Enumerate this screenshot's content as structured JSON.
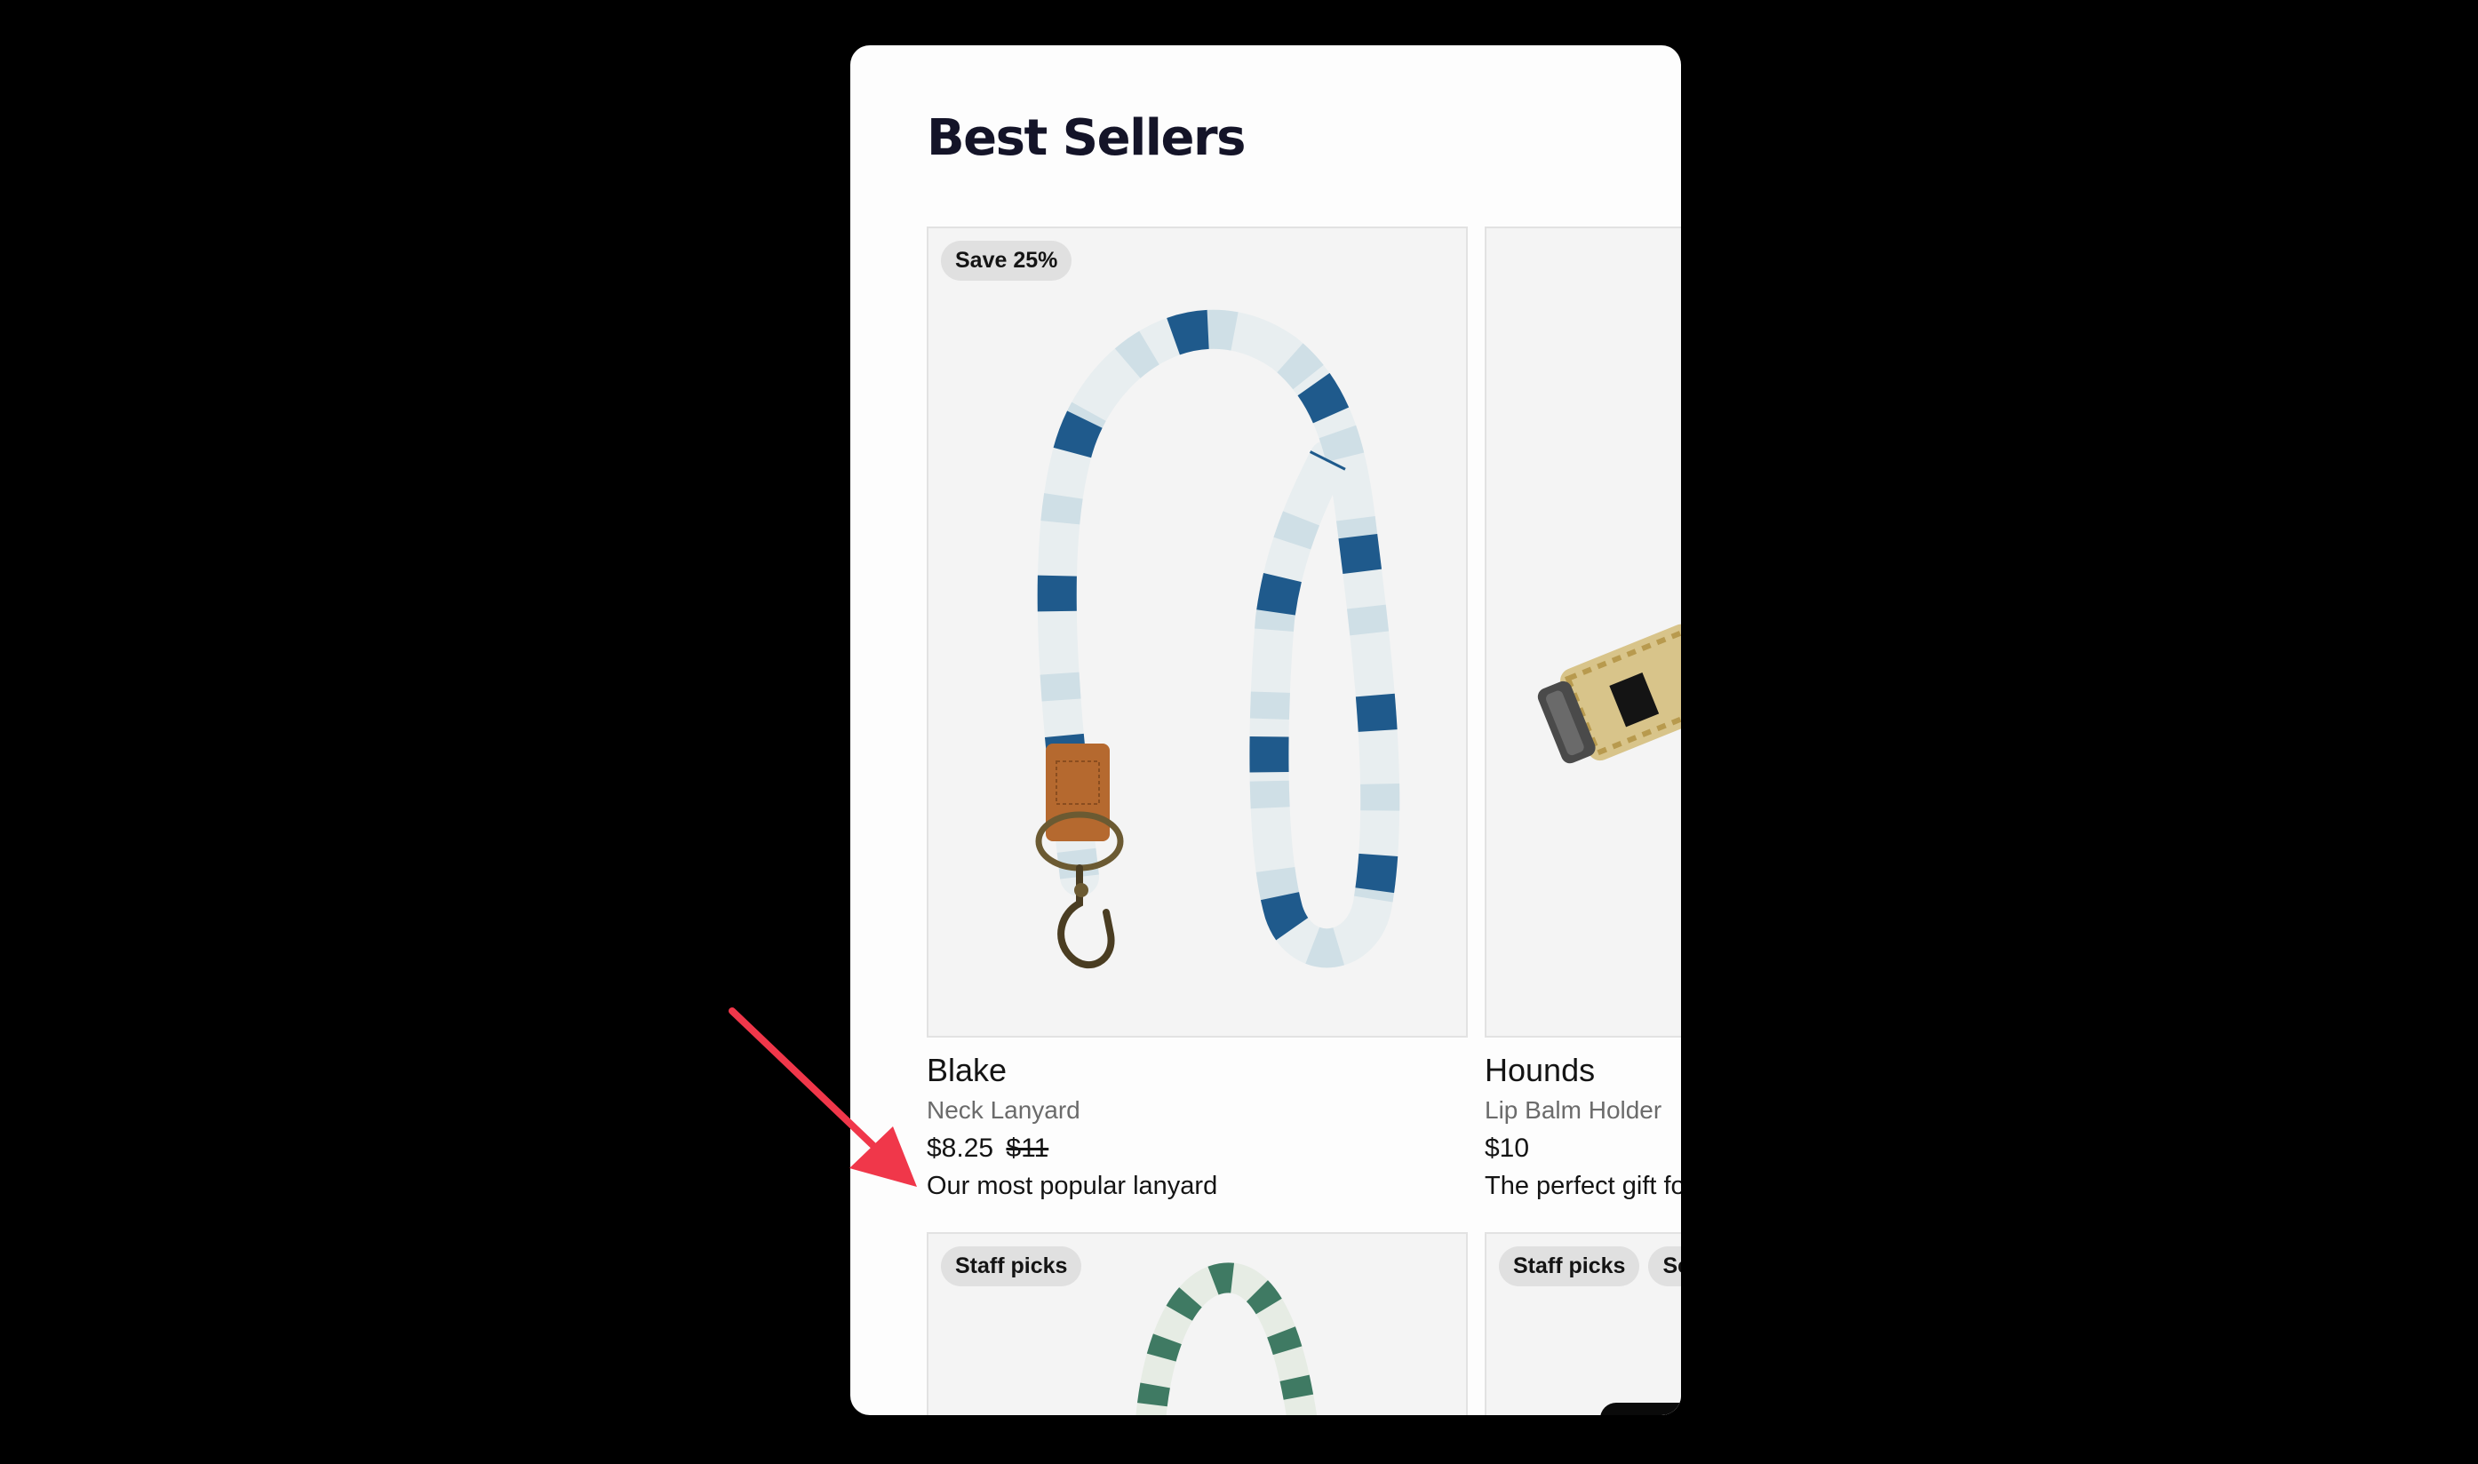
{
  "section": {
    "title": "Best Sellers"
  },
  "products": [
    {
      "badges": [
        "Save 25%"
      ],
      "name": "Blake",
      "type": "Neck Lanyard",
      "price": "$8.25",
      "old_price": "$11",
      "tagline": "Our most popular lanyard",
      "image_icon": "neck-lanyard-image"
    },
    {
      "badges": [],
      "name": "Hounds",
      "type": "Lip Balm Holder",
      "price": "$10",
      "tagline": "The perfect gift fo",
      "image_icon": "lip-balm-holder-image"
    },
    {
      "badges": [
        "Staff picks"
      ],
      "image_icon": "lanyard-image"
    },
    {
      "badges": [
        "Staff picks",
        "Se"
      ],
      "image_icon": "product-image"
    }
  ],
  "annotation": {
    "arrow_color": "#f0374a",
    "arrow_icon": "arrow-annotation-icon"
  },
  "colors": {
    "background": "#000000",
    "panel": "#fdfdfd",
    "heading": "#141428",
    "badge": "#e0e0e0",
    "lanyard_blue": "#1f5a8c",
    "leather": "#b5692f"
  }
}
